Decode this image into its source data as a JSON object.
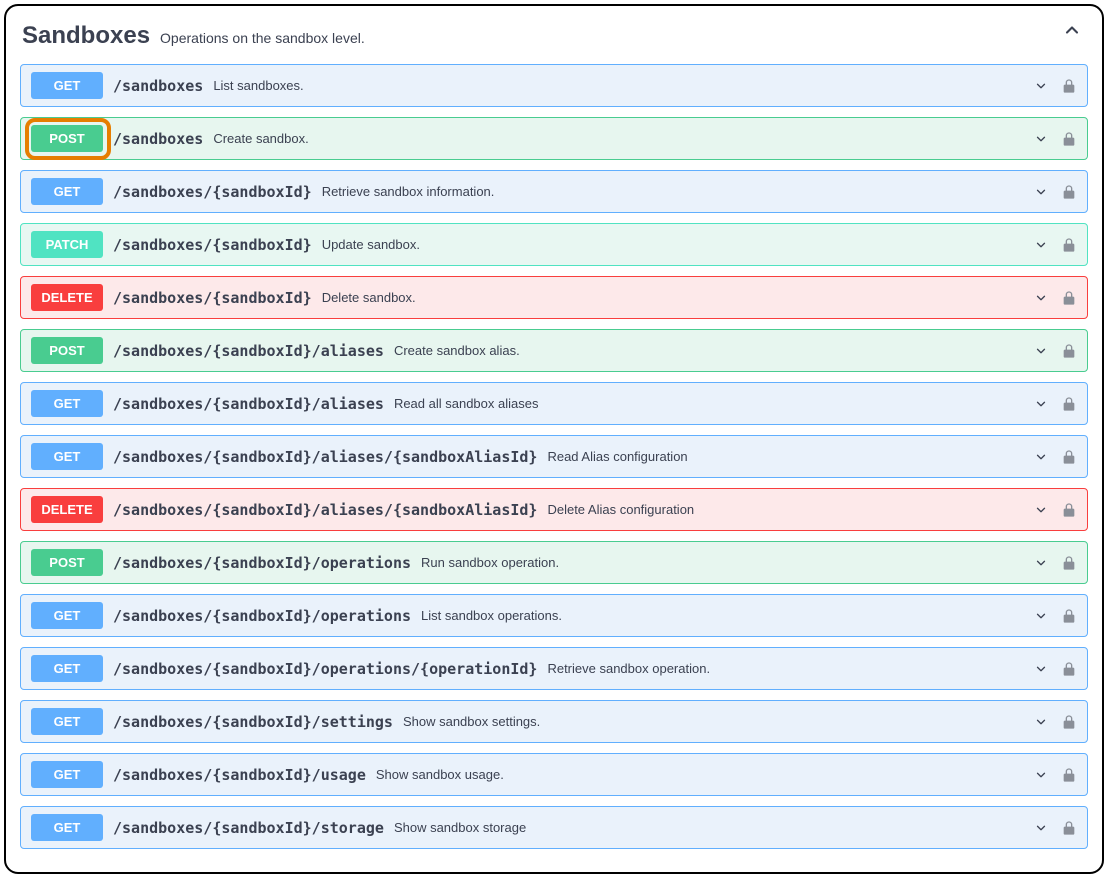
{
  "section": {
    "title": "Sandboxes",
    "description": "Operations on the sandbox level."
  },
  "methods": {
    "get": "GET",
    "post": "POST",
    "patch": "PATCH",
    "delete": "DELETE"
  },
  "operations": [
    {
      "method": "get",
      "path": "/sandboxes",
      "summary": "List sandboxes.",
      "highlight": false
    },
    {
      "method": "post",
      "path": "/sandboxes",
      "summary": "Create sandbox.",
      "highlight": true
    },
    {
      "method": "get",
      "path": "/sandboxes/{sandboxId}",
      "summary": "Retrieve sandbox information.",
      "highlight": false
    },
    {
      "method": "patch",
      "path": "/sandboxes/{sandboxId}",
      "summary": "Update sandbox.",
      "highlight": false
    },
    {
      "method": "delete",
      "path": "/sandboxes/{sandboxId}",
      "summary": "Delete sandbox.",
      "highlight": false
    },
    {
      "method": "post",
      "path": "/sandboxes/{sandboxId}/aliases",
      "summary": "Create sandbox alias.",
      "highlight": false
    },
    {
      "method": "get",
      "path": "/sandboxes/{sandboxId}/aliases",
      "summary": "Read all sandbox aliases",
      "highlight": false
    },
    {
      "method": "get",
      "path": "/sandboxes/{sandboxId}/aliases/{sandboxAliasId}",
      "summary": "Read Alias configuration",
      "highlight": false
    },
    {
      "method": "delete",
      "path": "/sandboxes/{sandboxId}/aliases/{sandboxAliasId}",
      "summary": "Delete Alias configuration",
      "highlight": false
    },
    {
      "method": "post",
      "path": "/sandboxes/{sandboxId}/operations",
      "summary": "Run sandbox operation.",
      "highlight": false
    },
    {
      "method": "get",
      "path": "/sandboxes/{sandboxId}/operations",
      "summary": "List sandbox operations.",
      "highlight": false
    },
    {
      "method": "get",
      "path": "/sandboxes/{sandboxId}/operations/{operationId}",
      "summary": "Retrieve sandbox operation.",
      "highlight": false
    },
    {
      "method": "get",
      "path": "/sandboxes/{sandboxId}/settings",
      "summary": "Show sandbox settings.",
      "highlight": false
    },
    {
      "method": "get",
      "path": "/sandboxes/{sandboxId}/usage",
      "summary": "Show sandbox usage.",
      "highlight": false
    },
    {
      "method": "get",
      "path": "/sandboxes/{sandboxId}/storage",
      "summary": "Show sandbox storage",
      "highlight": false
    }
  ]
}
